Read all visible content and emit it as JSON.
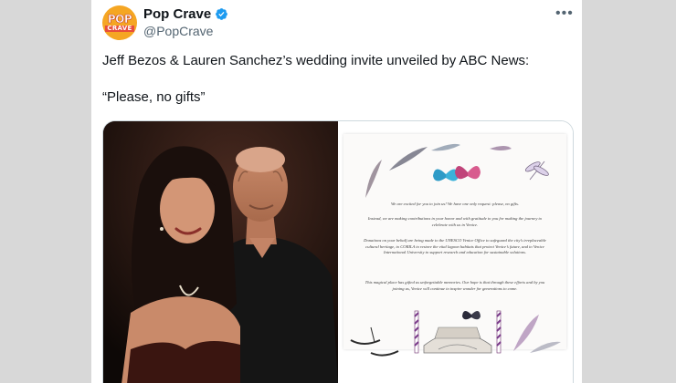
{
  "author": {
    "avatar_text_top": "POP",
    "avatar_text_bottom": "CRAVE",
    "display_name": "Pop Crave",
    "handle": "@PopCrave",
    "verified_color": "#1d9bf0",
    "verified_icon": "verified-badge-icon"
  },
  "more_icon": "•••",
  "tweet": {
    "line1": "Jeff Bezos & Lauren Sanchez’s wedding invite unveiled by ABC News:",
    "line2": "“Please, no gifts”"
  },
  "invite": {
    "p1": "We are excited for you to join us! We have one only request: please, no gifts.",
    "p2": "Instead, we are making contributions in your honor and with gratitude to you for making the journey to celebrate with us in Venice.",
    "p3": "Donations on your behalf are being made to the UNESCO Venice Office to safeguard the city’s irreplaceable cultural heritage, to CORILA to restore the vital lagoon habitats that protect Venice’s future, and to Venice International University to support research and education for sustainable solutions.",
    "p4": "This magical place has gifted us unforgettable memories. Our hope is that through these efforts and by you joining us, Venice will continue to inspire wonder for generations to come."
  }
}
